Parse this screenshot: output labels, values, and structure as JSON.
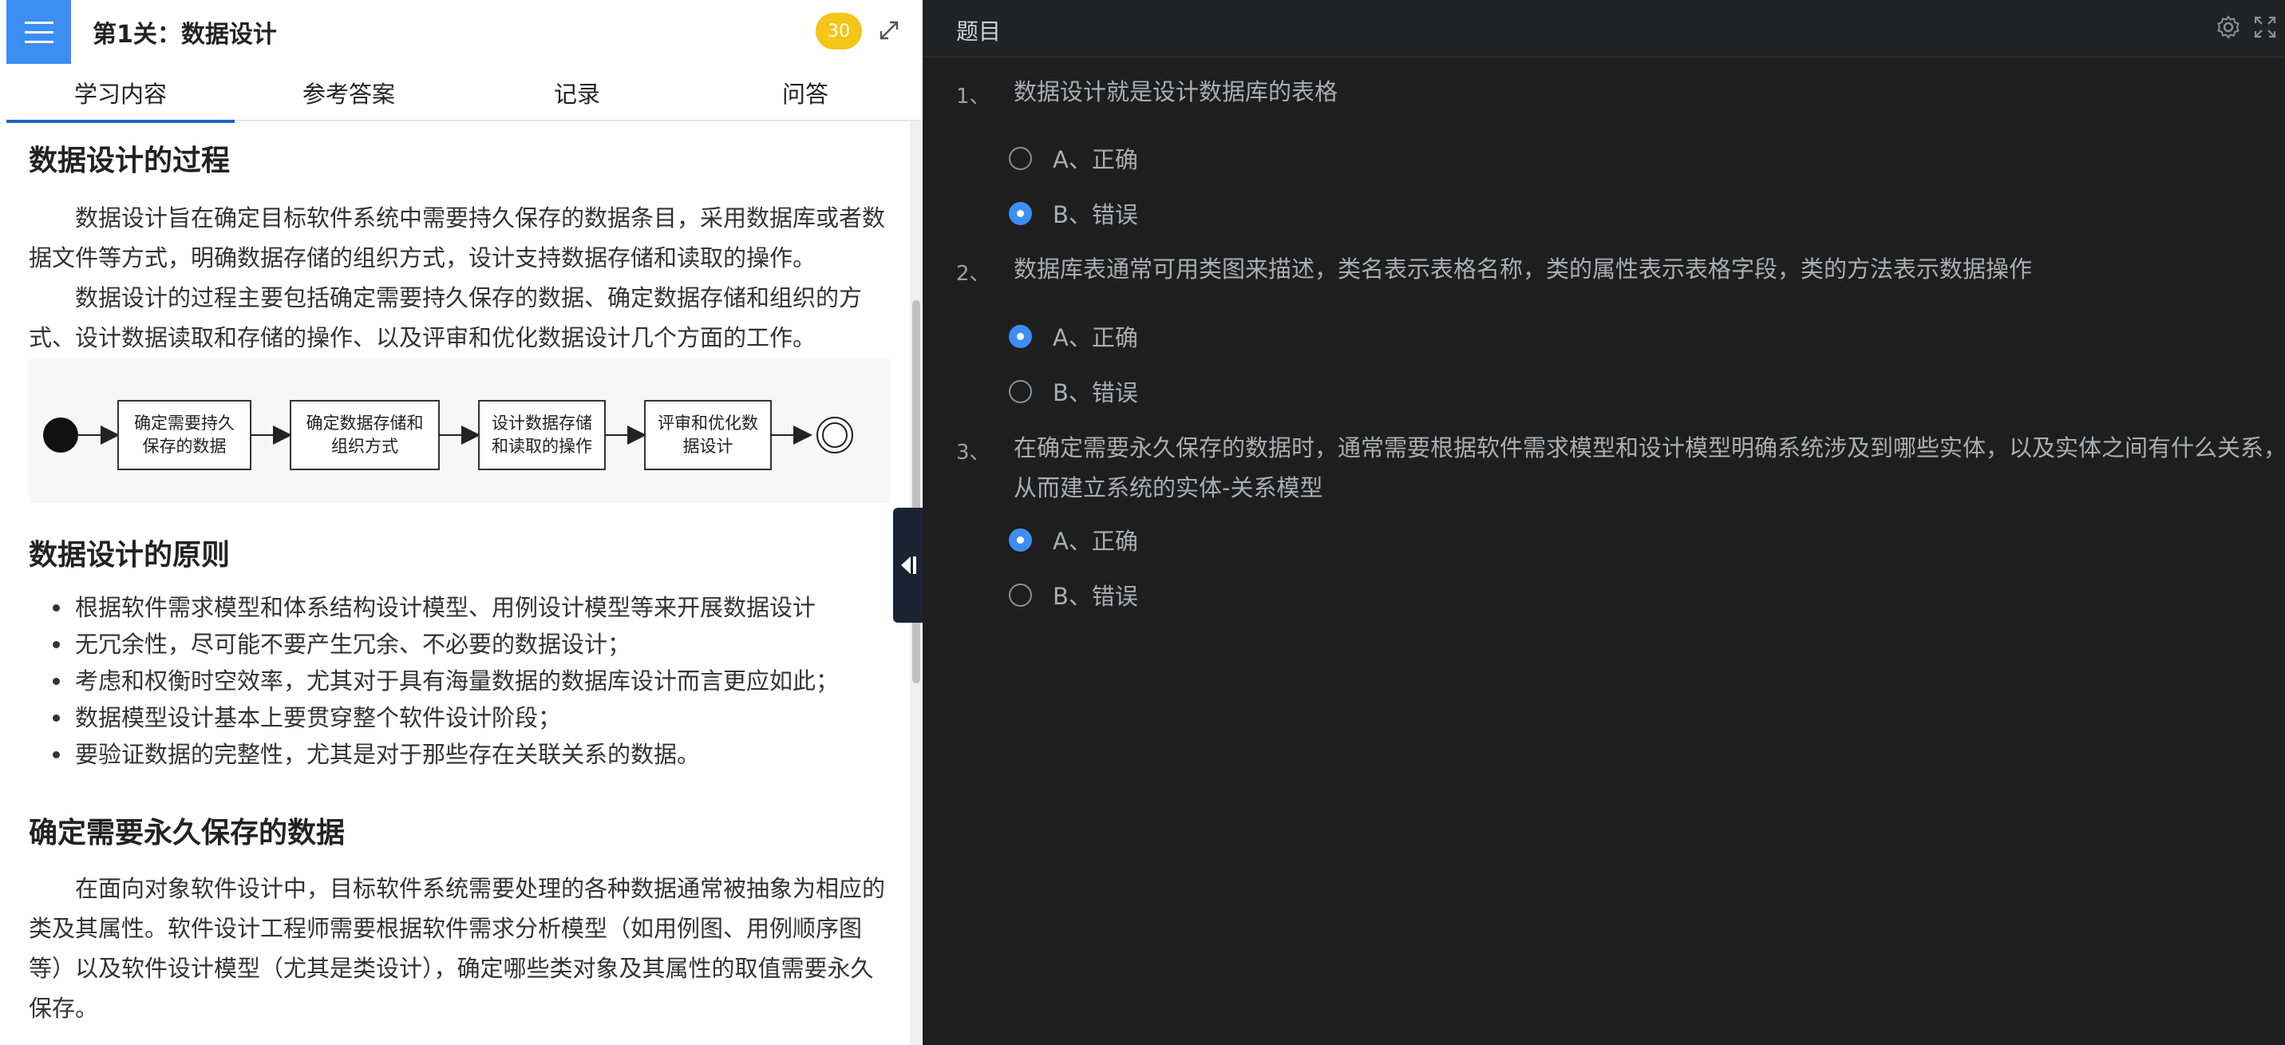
{
  "header": {
    "title": "第1关：数据设计",
    "score": "30"
  },
  "tabs": [
    {
      "label": "学习内容",
      "active": true
    },
    {
      "label": "参考答案",
      "active": false
    },
    {
      "label": "记录",
      "active": false
    },
    {
      "label": "问答",
      "active": false
    }
  ],
  "content": {
    "process_heading": "数据设计的过程",
    "process_p1": "数据设计旨在确定目标软件系统中需要持久保存的数据条目，采用数据库或者数据文件等方式，明确数据存储的组织方式，设计支持数据存储和读取的操作。",
    "process_p2": "数据设计的过程主要包括确定需要持久保存的数据、确定数据存储和组织的方式、设计数据读取和存储的操作、以及评审和优化数据设计几个方面的工作。",
    "diagram": {
      "steps": [
        [
          "确定需要持久",
          "保存的数据"
        ],
        [
          "确定数据存储和",
          "组织方式"
        ],
        [
          "设计数据存储",
          "和读取的操作"
        ],
        [
          "评审和优化数",
          "据设计"
        ]
      ]
    },
    "principle_heading": "数据设计的原则",
    "principles": [
      "根据软件需求模型和体系结构设计模型、用例设计模型等来开展数据设计",
      "无冗余性，尽可能不要产生冗余、不必要的数据设计；",
      "考虑和权衡时空效率，尤其对于具有海量数据的数据库设计而言更应如此；",
      "数据模型设计基本上要贯穿整个软件设计阶段；",
      "要验证数据的完整性，尤其是对于那些存在关联关系的数据。"
    ],
    "persist_heading": "确定需要永久保存的数据",
    "persist_p1": "在面向对象软件设计中，目标软件系统需要处理的各种数据通常被抽象为相应的类及其属性。软件设计工程师需要根据软件需求分析模型（如用例图、用例顺序图等）以及软件设计模型（尤其是类设计），确定哪些类对象及其属性的取值需要永久保存。"
  },
  "right": {
    "title": "题目",
    "questions": [
      {
        "num": "1、",
        "text": "数据设计就是设计数据库的表格",
        "options": [
          {
            "label": "A、正确",
            "checked": false
          },
          {
            "label": "B、错误",
            "checked": true
          }
        ]
      },
      {
        "num": "2、",
        "text": "数据库表通常可用类图来描述，类名表示表格名称，类的属性表示表格字段，类的方法表示数据操作",
        "options": [
          {
            "label": "A、正确",
            "checked": true
          },
          {
            "label": "B、错误",
            "checked": false
          }
        ]
      },
      {
        "num": "3、",
        "text": "在确定需要永久保存的数据时，通常需要根据软件需求模型和设计模型明确系统涉及到哪些实体，以及实体之间有什么关系，从而建立系统的实体-关系模型",
        "options": [
          {
            "label": "A、正确",
            "checked": true
          },
          {
            "label": "B、错误",
            "checked": false
          }
        ]
      }
    ]
  },
  "colors": {
    "accent": "#3d8ef2",
    "tab_underline": "#1e64c8",
    "badge": "#f5c518",
    "dark_bg": "#1e1e1e"
  }
}
